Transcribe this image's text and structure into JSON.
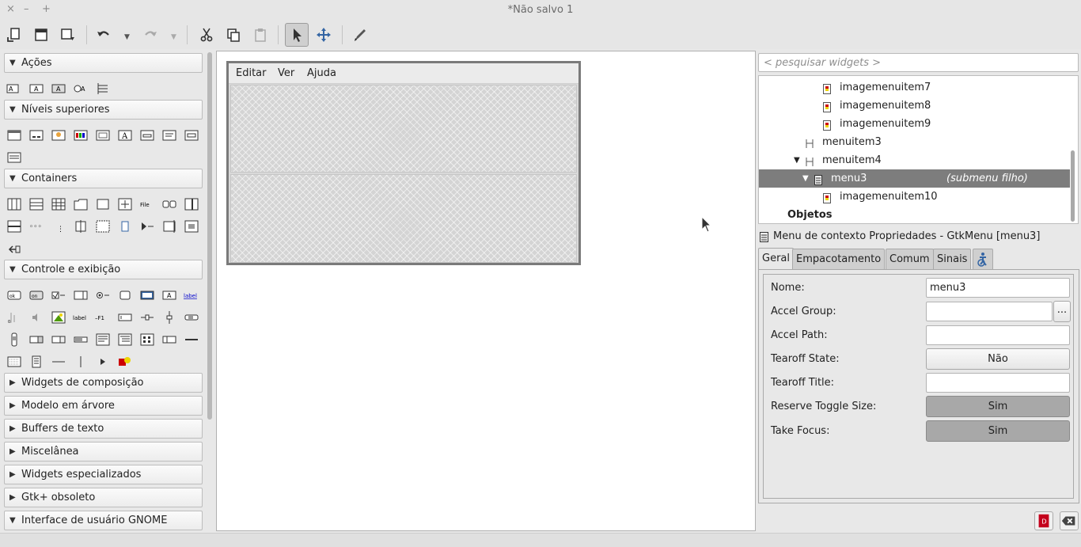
{
  "window": {
    "title": "*Não salvo 1",
    "controls": [
      "×",
      "–",
      "+"
    ]
  },
  "toolbar": {
    "buttons": [
      "new-file-icon",
      "open-file-icon",
      "save-icon",
      "undo-icon",
      "redo-icon",
      "cut-icon",
      "copy-icon",
      "paste-icon",
      "select-pointer-icon",
      "drag-resize-icon",
      "edit-pencil-icon"
    ]
  },
  "palette": {
    "categories": [
      {
        "label": "Ações",
        "expanded": true
      },
      {
        "label": "Níveis superiores",
        "expanded": true
      },
      {
        "label": "Containers",
        "expanded": true
      },
      {
        "label": "Controle e exibição",
        "expanded": true
      },
      {
        "label": "Widgets de composição",
        "expanded": false
      },
      {
        "label": "Modelo em árvore",
        "expanded": false
      },
      {
        "label": "Buffers de texto",
        "expanded": false
      },
      {
        "label": "Miscelânea",
        "expanded": false
      },
      {
        "label": "Widgets especializados",
        "expanded": false
      },
      {
        "label": "Gtk+ obsoleto",
        "expanded": false
      },
      {
        "label": "Interface de usuário GNOME",
        "expanded": true
      }
    ]
  },
  "canvas": {
    "menubar": [
      "Editar",
      "Ver",
      "Ajuda"
    ]
  },
  "search": {
    "placeholder": "< pesquisar widgets >"
  },
  "tree": {
    "rows": [
      {
        "label": "imagemenuitem7",
        "note": "",
        "selected": false
      },
      {
        "label": "imagemenuitem8",
        "note": "",
        "selected": false
      },
      {
        "label": "imagemenuitem9",
        "note": "",
        "selected": false
      },
      {
        "label": "menuitem3",
        "note": "",
        "selected": false
      },
      {
        "label": "menuitem4",
        "note": "",
        "selected": false
      },
      {
        "label": "menu3",
        "note": "(submenu filho)",
        "selected": true
      },
      {
        "label": "imagemenuitem10",
        "note": "",
        "selected": false
      },
      {
        "label": "Objetos",
        "note": "",
        "selected": false
      }
    ]
  },
  "properties": {
    "title": "Menu de contexto Propriedades - GtkMenu [menu3]",
    "tabs": [
      "Geral",
      "Empacotamento",
      "Comum",
      "Sinais"
    ],
    "accessibility_tab_icon": "accessibility-icon",
    "fields": {
      "name_label": "Nome:",
      "name_value": "menu3",
      "accel_group_label": "Accel Group:",
      "accel_group_value": "",
      "accel_group_button": "...",
      "accel_path_label": "Accel Path:",
      "accel_path_value": "",
      "tearoff_state_label": "Tearoff State:",
      "tearoff_state_value": "Não",
      "tearoff_title_label": "Tearoff Title:",
      "tearoff_title_value": "",
      "reserve_toggle_label": "Reserve Toggle Size:",
      "reserve_toggle_value": "Sim",
      "take_focus_label": "Take Focus:",
      "take_focus_value": "Sim"
    }
  },
  "colors": {
    "selection": "#7d7d7d",
    "accent_blue": "#3465a4",
    "toggle_down": "#a8a8a8"
  }
}
